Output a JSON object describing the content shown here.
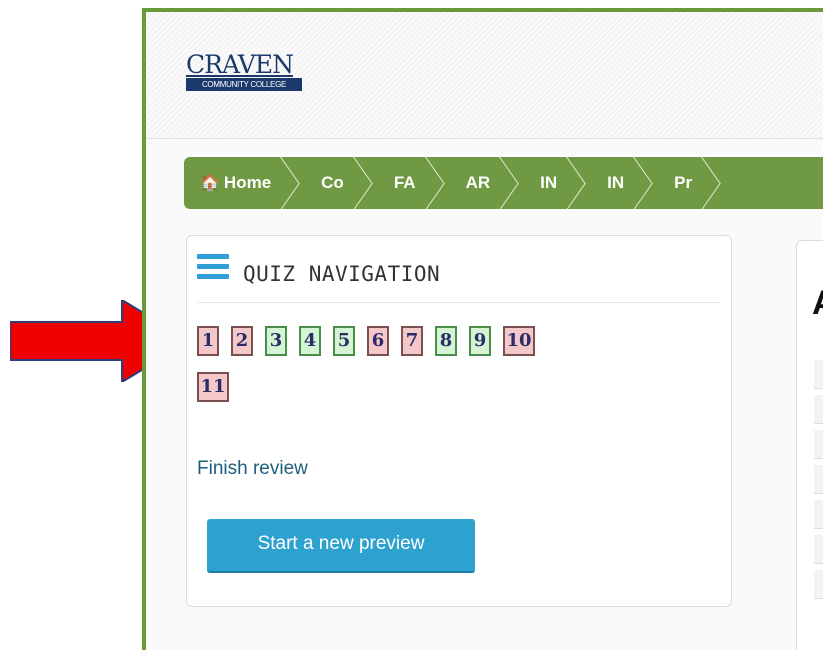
{
  "logo": {
    "line1": "CRAVEN",
    "line2": "COMMUNITY COLLEGE"
  },
  "breadcrumb": {
    "items": [
      {
        "label": "Home",
        "icon": "home-icon"
      },
      {
        "label": "Co"
      },
      {
        "label": "FA"
      },
      {
        "label": "AR"
      },
      {
        "label": "IN"
      },
      {
        "label": "IN"
      },
      {
        "label": "Pr"
      }
    ]
  },
  "quiz_nav": {
    "title": "QUIZ NAVIGATION",
    "questions": [
      {
        "label": "1",
        "status": "wrong"
      },
      {
        "label": "2",
        "status": "wrong"
      },
      {
        "label": "3",
        "status": "right"
      },
      {
        "label": "4",
        "status": "right"
      },
      {
        "label": "5",
        "status": "right"
      },
      {
        "label": "6",
        "status": "wrong"
      },
      {
        "label": "7",
        "status": "wrong"
      },
      {
        "label": "8",
        "status": "right"
      },
      {
        "label": "9",
        "status": "right"
      },
      {
        "label": "10",
        "status": "wrong"
      },
      {
        "label": "11",
        "status": "wrong"
      }
    ],
    "finish_link": "Finish review",
    "preview_button": "Start a new preview"
  },
  "right_panel": {
    "heading_fragment": "A"
  },
  "colors": {
    "breadcrumb_bg": "#6f9a43",
    "frame_border": "#6a9a3e",
    "button_bg": "#2ea2cf",
    "wrong_fill": "#f4c8c8",
    "right_fill": "#d4f5d4",
    "arrow": "#ee0000"
  }
}
